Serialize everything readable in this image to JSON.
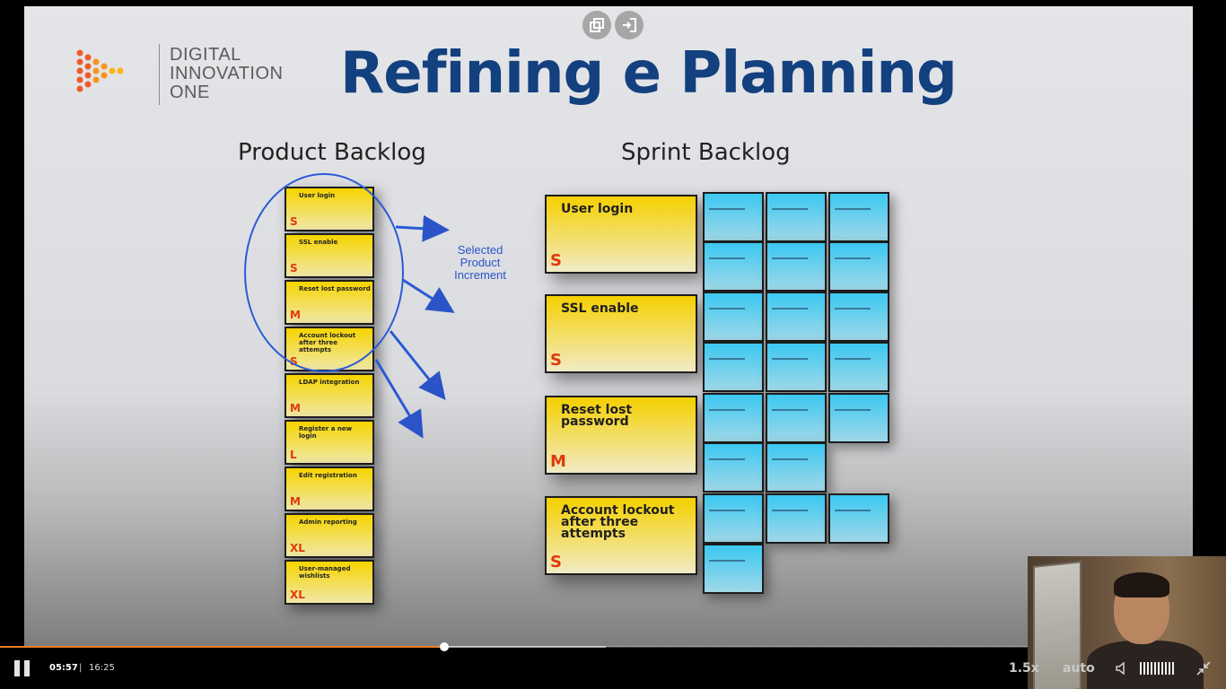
{
  "slide": {
    "title": "Refining e Planning",
    "logo": {
      "line1": "DIGITAL",
      "line2": "INNOVATION",
      "line3": "ONE"
    },
    "product_backlog_heading": "Product Backlog",
    "sprint_backlog_heading": "Sprint Backlog",
    "selected_label": "Selected Product Increment",
    "product_backlog": [
      {
        "label": "User login",
        "size": "S"
      },
      {
        "label": "SSL enable",
        "size": "S"
      },
      {
        "label": "Reset lost password",
        "size": "M"
      },
      {
        "label": "Account lockout after three attempts",
        "size": "S"
      },
      {
        "label": "LDAP integration",
        "size": "M"
      },
      {
        "label": "Register a new login",
        "size": "L"
      },
      {
        "label": "Edit registration",
        "size": "M"
      },
      {
        "label": "Admin reporting",
        "size": "XL"
      },
      {
        "label": "User-managed wishlists",
        "size": "XL"
      }
    ],
    "sprint_backlog": [
      {
        "label": "User login",
        "size": "S"
      },
      {
        "label": "SSL enable",
        "size": "S"
      },
      {
        "label": "Reset lost password",
        "size": "M"
      },
      {
        "label": "Account lockout after three attempts",
        "size": "S"
      }
    ]
  },
  "player": {
    "current_time": "05:57",
    "separator": "|",
    "total_time": "16:25",
    "speed": "1.5x",
    "quality": "auto",
    "progress_fraction": 0.362,
    "buffered_fraction": 0.493,
    "icons": {
      "popout": "popout-icon",
      "exit": "exit-icon",
      "pause": "pause-icon",
      "volume": "volume-icon",
      "minimize": "minimize-icon"
    }
  }
}
